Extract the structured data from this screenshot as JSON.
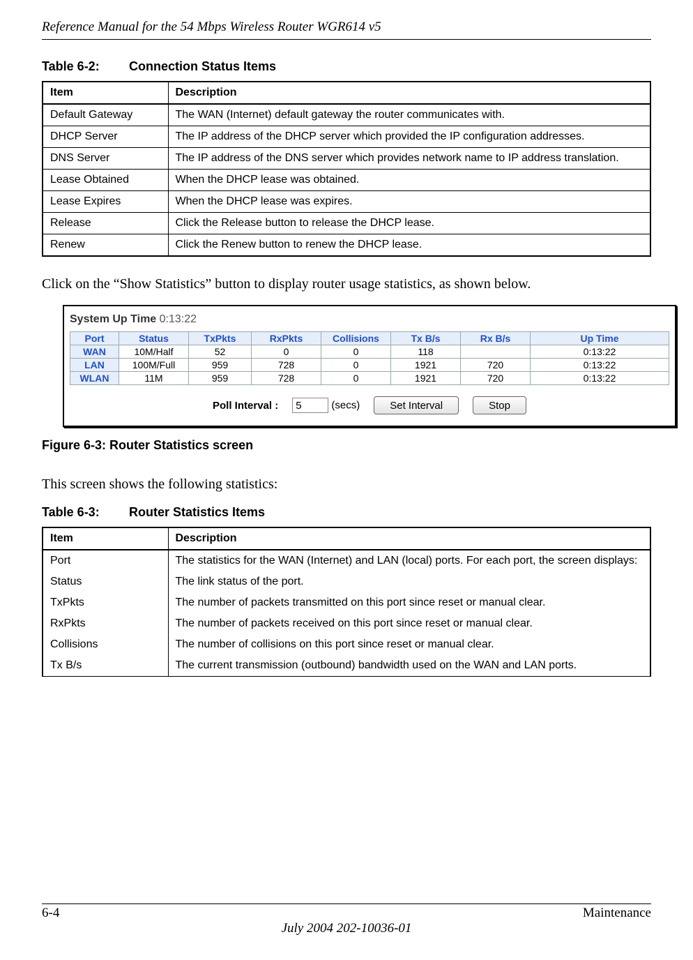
{
  "header": {
    "title": "Reference Manual for the 54 Mbps Wireless Router WGR614 v5"
  },
  "table62": {
    "number": "Table 6-2:",
    "title": "Connection Status Items",
    "col_item": "Item",
    "col_desc": "Description",
    "rows": [
      {
        "item": "Default Gateway",
        "desc": "The WAN (Internet) default gateway the router communicates with."
      },
      {
        "item": "DHCP Server",
        "desc": "The IP address of the DHCP server which provided the IP configuration addresses."
      },
      {
        "item": "DNS Server",
        "desc": "The IP address of the DNS server which provides network name to IP address translation."
      },
      {
        "item": "Lease Obtained",
        "desc": "When the DHCP lease was obtained."
      },
      {
        "item": "Lease Expires",
        "desc": "When the DHCP lease was expires."
      },
      {
        "item": "Release",
        "desc": "Click the Release button to release the DHCP lease."
      },
      {
        "item": "Renew",
        "desc": "Click the Renew button to renew the DHCP lease."
      }
    ]
  },
  "para1": "Click on the “Show Statistics” button to display router usage statistics, as shown below.",
  "stats_screen": {
    "uptime_label": "System Up Time",
    "uptime_value": "0:13:22",
    "headers": [
      "Port",
      "Status",
      "TxPkts",
      "RxPkts",
      "Collisions",
      "Tx B/s",
      "Rx B/s",
      "Up Time"
    ],
    "rows": [
      {
        "port": "WAN",
        "status": "10M/Half",
        "tx": "52",
        "rx": "0",
        "col": "0",
        "txbs": "118",
        "rxbs": "",
        "up": "0:13:22"
      },
      {
        "port": "LAN",
        "status": "100M/Full",
        "tx": "959",
        "rx": "728",
        "col": "0",
        "txbs": "1921",
        "rxbs": "720",
        "up": "0:13:22"
      },
      {
        "port": "WLAN",
        "status": "11M",
        "tx": "959",
        "rx": "728",
        "col": "0",
        "txbs": "1921",
        "rxbs": "720",
        "up": "0:13:22"
      }
    ],
    "poll_label": "Poll Interval :",
    "poll_value": "5",
    "poll_units": "(secs)",
    "btn_set": "Set Interval",
    "btn_stop": "Stop"
  },
  "figure_caption": "Figure 6-3:  Router Statistics screen",
  "para2": "This screen shows the following statistics:",
  "table63": {
    "number": "Table 6-3:",
    "title": "Router Statistics Items",
    "col_item": "Item",
    "col_desc": "Description",
    "rows": [
      {
        "item": "Port",
        "indent": false,
        "desc": "The statistics for the WAN (Internet) and LAN (local) ports. For each port, the screen displays:"
      },
      {
        "item": "Status",
        "indent": true,
        "desc": "The link status of the port."
      },
      {
        "item": "TxPkts",
        "indent": true,
        "desc": "The number of packets transmitted on this port since reset or manual clear."
      },
      {
        "item": "RxPkts",
        "indent": true,
        "desc": "The number of packets received on this port since reset or manual clear."
      },
      {
        "item": "Collisions",
        "indent": true,
        "desc": "The number of collisions on this port since reset or manual clear."
      },
      {
        "item": "Tx B/s",
        "indent": true,
        "desc": "The current transmission (outbound) bandwidth used on the WAN and LAN ports."
      }
    ]
  },
  "footer": {
    "page": "6-4",
    "section": "Maintenance",
    "date": "July 2004 202-10036-01"
  }
}
